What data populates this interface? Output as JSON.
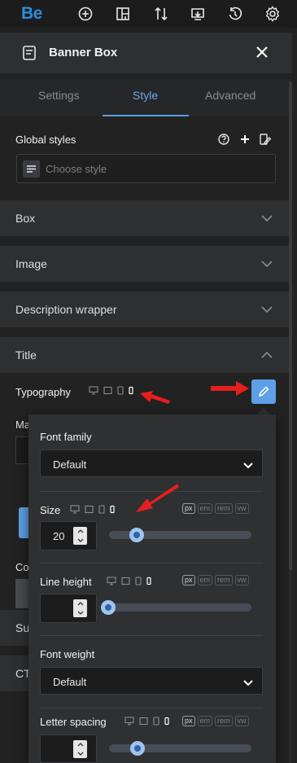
{
  "topbar": {
    "logo": "Be",
    "icons": [
      "add-icon",
      "layout-icon",
      "sort-icon",
      "import-icon",
      "history-icon",
      "settings-icon"
    ]
  },
  "panel": {
    "title": "Banner Box",
    "icon": "banner-box-icon"
  },
  "tabs": [
    {
      "label": "Settings",
      "active": false
    },
    {
      "label": "Style",
      "active": true
    },
    {
      "label": "Advanced",
      "active": false
    }
  ],
  "global_styles": {
    "label": "Global styles",
    "placeholder": "Choose style"
  },
  "sections": [
    {
      "label": "Box"
    },
    {
      "label": "Image"
    },
    {
      "label": "Description wrapper"
    },
    {
      "label": "Title",
      "expanded": true
    }
  ],
  "typography": {
    "label": "Typography"
  },
  "underlying": {
    "margin_label_fragment": "Ma",
    "color_label_fragment": "Co",
    "section3_fragment": "Su",
    "section4_fragment": "CT"
  },
  "popup": {
    "font_family": {
      "label": "Font family",
      "value": "Default"
    },
    "size": {
      "label": "Size",
      "value": "20",
      "units": [
        "px",
        "em",
        "rem",
        "vw"
      ],
      "active_unit": "px"
    },
    "line_height": {
      "label": "Line height",
      "value": "",
      "units": [
        "px",
        "em",
        "rem",
        "vw"
      ],
      "active_unit": "px"
    },
    "font_weight": {
      "label": "Font weight",
      "value": "Default"
    },
    "letter_spacing": {
      "label": "Letter spacing",
      "value": "",
      "units": [
        "px",
        "em",
        "rem",
        "vw"
      ],
      "active_unit": "px"
    }
  },
  "colors": {
    "accent": "#5e9fe6",
    "annotation_arrow": "#e81e1e"
  }
}
